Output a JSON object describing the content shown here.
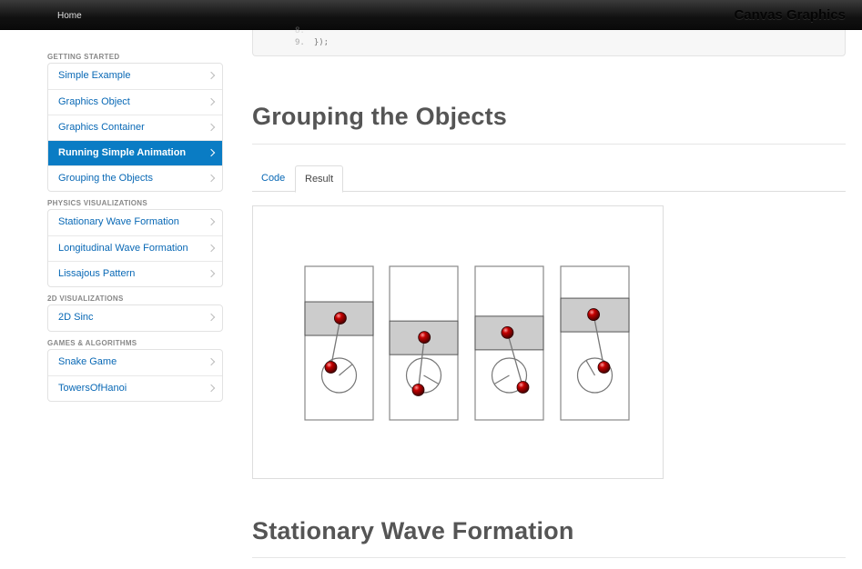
{
  "navbar": {
    "home_label": "Home",
    "brand": "Canvas Graphics"
  },
  "sidebar": {
    "sections": [
      {
        "header": "GETTING STARTED",
        "items": [
          "Simple Example",
          "Graphics Object",
          "Graphics Container",
          "Running Simple Animation",
          "Grouping the Objects"
        ],
        "active_index": 3
      },
      {
        "header": "PHYSICS VISUALIZATIONS",
        "items": [
          "Stationary Wave Formation",
          "Longitudinal Wave Formation",
          "Lissajous Pattern"
        ]
      },
      {
        "header": "2D VISUALIZATIONS",
        "items": [
          "2D Sinc"
        ]
      },
      {
        "header": "GAMES & ALGORITHMS",
        "items": [
          "Snake Game",
          "TowersOfHanoi"
        ]
      }
    ]
  },
  "code_stub": {
    "faded_line_number": "8.",
    "last_line_number": "9.",
    "last_line_code": "});"
  },
  "main": {
    "section_title": "Grouping the Objects",
    "tabs": [
      {
        "label": "Code"
      },
      {
        "label": "Result"
      }
    ],
    "active_tab": "Result",
    "next_section_title": "Stationary Wave Formation"
  },
  "result_canvas": {
    "panels": [
      {
        "band_level": 0.22,
        "ball_top_angle_deg": 10,
        "ball_bottom": "left"
      },
      {
        "band_level": 0.38,
        "ball_top_angle_deg": 5,
        "ball_bottom": "bottom-left"
      },
      {
        "band_level": 0.34,
        "ball_top_angle_deg": 345,
        "ball_bottom": "bottom-right"
      },
      {
        "band_level": 0.19,
        "ball_top_angle_deg": 350,
        "ball_bottom": "right"
      }
    ],
    "colors": {
      "frame": "#888888",
      "band_fill": "#cccccc",
      "ball": "#b10000",
      "ball_highlight": "#ff8080",
      "wheel": "#777777"
    }
  }
}
